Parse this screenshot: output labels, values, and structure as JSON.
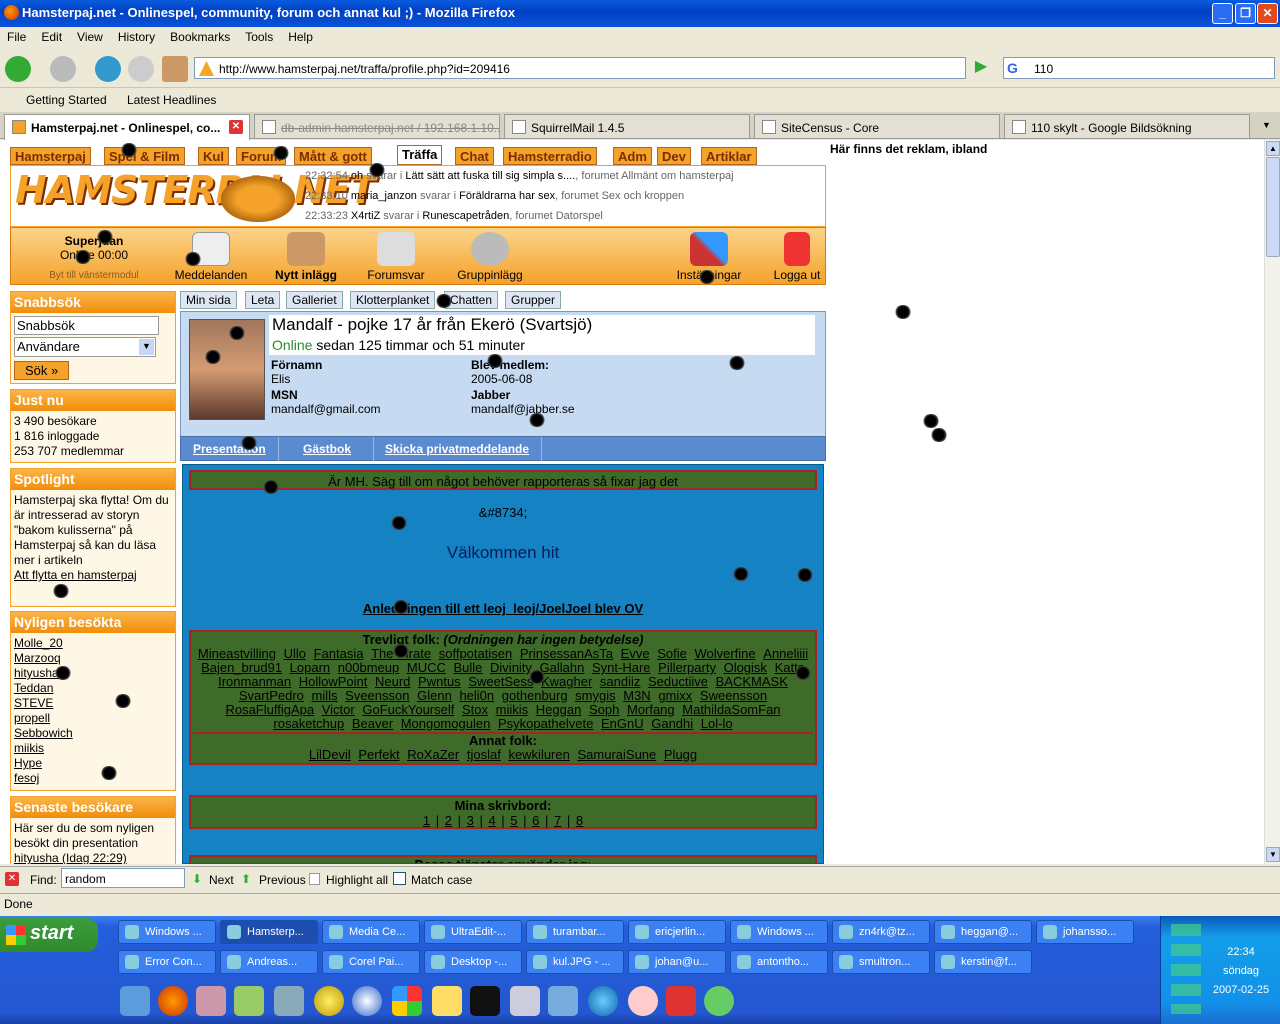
{
  "window": {
    "title": "Hamsterpaj.net - Onlinespel, community, forum och annat kul ;) - Mozilla Firefox"
  },
  "menu": [
    "File",
    "Edit",
    "View",
    "History",
    "Bookmarks",
    "Tools",
    "Help"
  ],
  "url": "http://www.hamsterpaj.net/traffa/profile.php?id=209416",
  "search_value": "110",
  "bookmarks": [
    "Getting Started",
    "Latest Headlines"
  ],
  "tabs": [
    "Hamsterpaj.net - Onlinespel, co...",
    "db-admin hamsterpaj.net / 192.168.1.10...",
    "SquirrelMail 1.4.5",
    "SiteCensus - Core",
    "110 skylt - Google Bildsökning"
  ],
  "site": {
    "nav": [
      "Hamsterpaj",
      "Spel & Film",
      "Kul",
      "Forum",
      "Mått & gott",
      "Träffa",
      "Chat",
      "Hamsterradio",
      "Adm",
      "Dev",
      "Artiklar"
    ],
    "logo": "HAMSTERPAJ.NET",
    "feed": [
      {
        "time": "22:32:54",
        "user": "oh",
        "text": "svarar i",
        "thread": "Lätt sätt att fuska till sig simpla s....",
        "forum": ", forumet Allmänt om hamsterpaj"
      },
      {
        "time": "22:33:10",
        "user": "maria_janzon",
        "text": "svarar i",
        "thread": "Föräldrarna har sex",
        "forum": ", forumet Sex och kroppen"
      },
      {
        "time": "22:33:23",
        "user": "X4rtiZ",
        "text": "svarar i",
        "thread": "Runescapetråden",
        "forum": ", forumet Datorspel"
      }
    ],
    "user": {
      "name": "Superjuan",
      "status": "Online 00:00",
      "switch": "Byt till vänstermodul"
    },
    "toolbar": [
      "Meddelanden",
      "Nytt inlägg",
      "Forumsvar",
      "Gruppinlägg",
      "Inställningar",
      "Logga ut"
    ],
    "ad": "Här finns det reklam, ibland",
    "quicksearch": {
      "title": "Snabbsök",
      "input": "Snabbsök",
      "select": "Användare",
      "button": "Sök »"
    },
    "justnu": {
      "title": "Just nu",
      "lines": [
        "3 490 besökare",
        "1 816 inloggade",
        "253 707 medlemmar"
      ]
    },
    "spotlight": {
      "title": "Spotlight",
      "text": "Hamsterpaj ska flytta! Om du är intresserad av storyn \"bakom kulisserna\" på Hamsterpaj så kan du läsa mer i artikeln",
      "link": "Att flytta en hamsterpaj"
    },
    "recent": {
      "title": "Nyligen besökta",
      "items": [
        "Molle_20",
        "Marzooq",
        "hityusha",
        "Teddan",
        "STEVE",
        "propell",
        "Sebbowich",
        "miikis",
        "Hype",
        "fesoj"
      ]
    },
    "lastvis": {
      "title": "Senaste besökare",
      "text": "Här ser du de som nyligen besökt din presentation",
      "line": "hityusha (Idag 22:29)"
    },
    "subtabs": [
      "Min sida",
      "Leta",
      "Galleriet",
      "Klotterplanket",
      "Chatten",
      "Grupper"
    ],
    "profile": {
      "title": "Mandalf - pojke 17 år från Ekerö (Svartsjö)",
      "online": "Online",
      "since": " sedan 125 timmar och 51 minuter",
      "fornamn_l": "Förnamn",
      "fornamn": "Elis",
      "blev_l": "Blev medlem:",
      "blev": "2005-06-08",
      "msn_l": "MSN",
      "msn": "mandalf@gmail.com",
      "jabber_l": "Jabber",
      "jabber": "mandalf@jabber.se"
    },
    "ptabs": [
      "Presentation",
      "Gästbok",
      "Skicka privatmeddelande"
    ],
    "pres": {
      "banner": "Är MH. Säg till om något behöver rapporteras så fixar jag det",
      "entity": "&#8734;",
      "welcome": "Välkommen hit",
      "reason": "Anledningen till ett leoj_leoj/JoelJoel blev OV",
      "nice_title": "Trevligt folk:",
      "nice_note": "(Ordningen har ingen betydelse)",
      "nice": [
        "Mineastvilling",
        "Ullo",
        "Fantasia",
        "The Pirate",
        "soffpotatisen",
        "PrinsessanAsTa",
        "Evve",
        "Sofie",
        "Wolverfine",
        "Anneliiii",
        "Bajen_brud91",
        "Loparn",
        "n00bmeup",
        "MUCC",
        "Bulle",
        "Divinity",
        "Gallahn",
        "Synt-Hare",
        "Pillerparty",
        "Ologisk",
        "Katto",
        "Ironmanman",
        "HollowPoint",
        "Neurd",
        "Pwntus",
        "SweetSess",
        "Kwagher",
        "sandiiz",
        "Seductiive",
        "BACKMASK",
        "SvartPedro",
        "mills",
        "Sveensson",
        "Glenn",
        "heli0n",
        "gothenburg",
        "smygis",
        "M3N",
        "gmixx",
        "Sweensson",
        "RosaFluffigApa",
        "Victor",
        "GoFuckYourself",
        "Stox",
        "miikis",
        "Heggan",
        "Soph",
        "Morfang",
        "MathildaSomFan",
        "rosaketchup",
        "Beaver",
        "Mongomogulen",
        "Psykopathelvete",
        "EnGnU",
        "Gandhi",
        "Lol-lo"
      ],
      "other_title": "Annat folk:",
      "other": [
        "LilDevil",
        "Perfekt",
        "RoXaZer",
        "tjoslaf",
        "kewkiluren",
        "SamuraiSune",
        "Plugg"
      ],
      "desks_title": "Mina skrivbord:",
      "desks": [
        "1",
        "2",
        "3",
        "4",
        "5",
        "6",
        "7",
        "8"
      ],
      "cut": "Dessa tjänster använder jag:"
    }
  },
  "find": {
    "label": "Find:",
    "value": "random",
    "next": "Next",
    "previous": "Previous",
    "highlight": "Highlight all",
    "match": "Match case"
  },
  "status": "Done",
  "taskbar": {
    "start": "start",
    "row1": [
      "Windows ...",
      "Hamsterp...",
      "Media Ce...",
      "UltraEdit-...",
      "turambar...",
      "ericjerlin...",
      "Windows ...",
      "zn4rk@tz...",
      "heggan@...",
      "johansso..."
    ],
    "row2": [
      "Error Con...",
      "Andreas...",
      "Corel Pai...",
      "Desktop -...",
      "kul.JPG - ...",
      "johan@u...",
      "antontho...",
      "smultron...",
      "kerstin@f..."
    ],
    "time": "22:34",
    "day": "söndag",
    "date": "2007-02-25"
  }
}
